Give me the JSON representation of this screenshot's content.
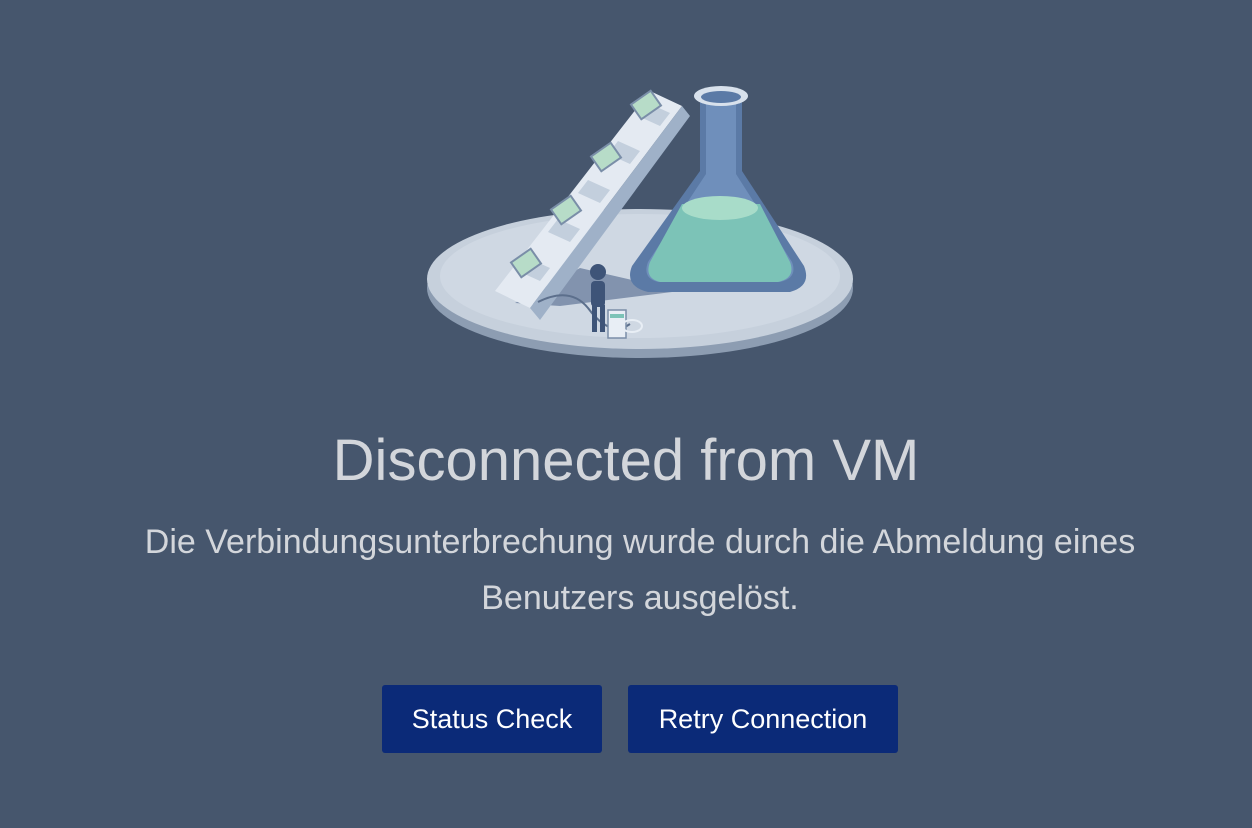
{
  "illustration": {
    "icon": "lab-flask-conveyor-illustration"
  },
  "title": "Disconnected from VM",
  "message": "Die Verbindungsunterbrechung wurde durch die Abmeldung eines Benutzers ausgelöst.",
  "buttons": {
    "status_check": "Status Check",
    "retry": "Retry Connection"
  },
  "colors": {
    "background": "#46566d",
    "text": "#d3d6db",
    "button": "#0b2a78",
    "button_text": "#ffffff"
  }
}
